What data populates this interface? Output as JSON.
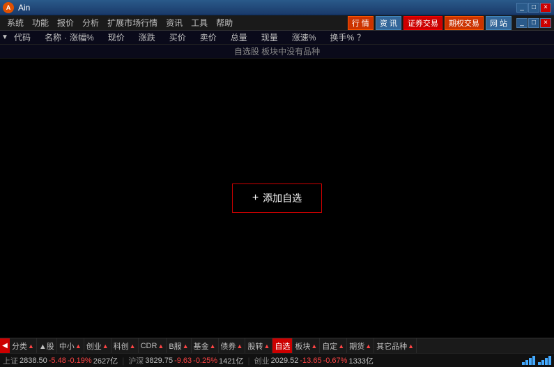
{
  "titlebar": {
    "logo_text": "A",
    "title": "Ain",
    "win_btns": [
      "_",
      "□",
      "×"
    ]
  },
  "menubar": {
    "items": [
      "系统",
      "功能",
      "报价",
      "分析",
      "扩展市场行情",
      "资讯",
      "工具",
      "帮助"
    ],
    "right_btns": [
      {
        "label": "行 情",
        "class": "btn-hang"
      },
      {
        "label": "资 讯",
        "class": "btn-zi"
      },
      {
        "label": "证券交易",
        "class": "btn-zq"
      },
      {
        "label": "期权交易",
        "class": "btn-qh"
      },
      {
        "label": "网 站",
        "class": "btn-wang"
      }
    ]
  },
  "col_headers": {
    "dropdown": "▼",
    "items": [
      "代码",
      "名称",
      "·",
      "涨幅%",
      "现价",
      "涨跌",
      "买价",
      "卖价",
      "总量",
      "现量",
      "涨速%",
      "换手%",
      "？"
    ]
  },
  "empty_notice": "自选股 板块中没有品种",
  "add_button": {
    "plus": "+",
    "label": "添加自选"
  },
  "tabs": [
    {
      "label": "分类",
      "arrow": "▲",
      "active": false
    },
    {
      "label": "▲股",
      "arrow": "",
      "active": false
    },
    {
      "label": "中小",
      "arrow": "▲",
      "active": false
    },
    {
      "label": "创业",
      "arrow": "▲",
      "active": false
    },
    {
      "label": "科创",
      "arrow": "▲",
      "active": false
    },
    {
      "label": "CDR",
      "arrow": "▲",
      "active": false
    },
    {
      "label": "B服",
      "arrow": "▲",
      "active": false
    },
    {
      "label": "基金",
      "arrow": "▲",
      "active": false
    },
    {
      "label": "债券",
      "arrow": "▲",
      "active": false
    },
    {
      "label": "股转",
      "arrow": "▲",
      "active": false
    },
    {
      "label": "自选",
      "arrow": "",
      "active": true
    },
    {
      "label": "板块",
      "arrow": "▲",
      "active": false
    },
    {
      "label": "自定",
      "arrow": "▲",
      "active": false
    },
    {
      "label": "期货",
      "arrow": "▲",
      "active": false
    },
    {
      "label": "其它品种",
      "arrow": "▲",
      "active": false
    }
  ],
  "statusbar": {
    "items": [
      {
        "label": "上证",
        "value": "2838.50",
        "change": "-5.48",
        "pct": "-0.19%",
        "vol": "2627亿"
      },
      {
        "label": "沪深",
        "value": "3829.75",
        "change": "-9.63",
        "pct": "-0.25%",
        "vol": "1421亿"
      },
      {
        "label": "创业",
        "value": "2029.52",
        "change": "-13.65",
        "pct": "-0.67%",
        "vol": "1333亿"
      }
    ]
  }
}
